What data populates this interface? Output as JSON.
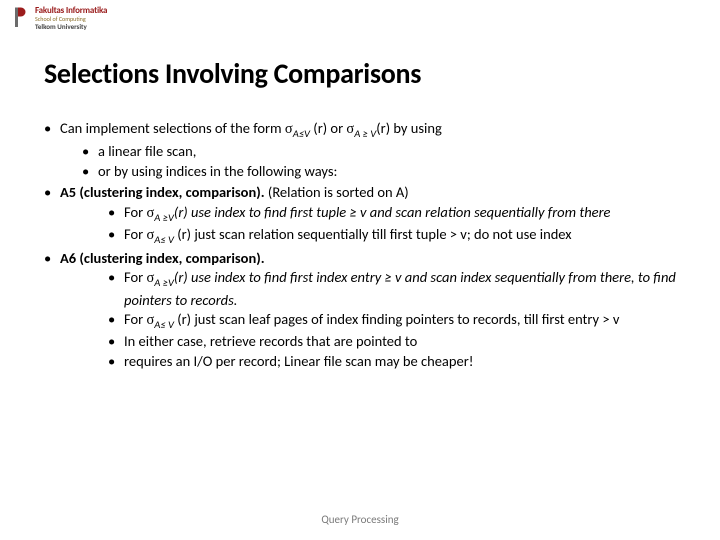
{
  "logo": {
    "title": "Fakultas Informatika",
    "subtitle": "School of Computing",
    "university": "Telkom University"
  },
  "title": "Selections Involving Comparisons",
  "b1": {
    "prefix": "Can implement selections of the form ",
    "mid": " (r) or ",
    "suffix": "(r) by using",
    "sub_a": "a linear file scan,",
    "sub_b": "or by using indices in the following ways:"
  },
  "b2": {
    "label": "A5 (clustering index, comparison).",
    "tail": " (Relation is sorted on A)",
    "s1_pre": "For ",
    "s1_post": "(r)  use index to find first tuple ≥ v  and scan relation sequentially from there",
    "s2_pre": "For ",
    "s2_post": " (r) just scan relation sequentially till first tuple > v; do not use index"
  },
  "b3": {
    "label": "A6 (clustering index, comparison).",
    "s1_pre": "For ",
    "s1_post": "(r)  use index to find first index entry ≥ v and scan index sequentially  from there, to find pointers to records.",
    "s2_pre": "For ",
    "s2_post": " (r) just scan leaf pages of index finding pointers to records, till first entry > v",
    "s3": "In either case, retrieve records that are pointed to",
    "s4": "requires an I/O per record; Linear file scan may be cheaper!"
  },
  "sym": {
    "sigma": "σ",
    "A_le_V": "A≤V",
    "A_ge_V": "A ≥ V",
    "A_ge_V2": "A ≥V",
    "A_le_V2": "A≤ V"
  },
  "footer": "Query Processing"
}
